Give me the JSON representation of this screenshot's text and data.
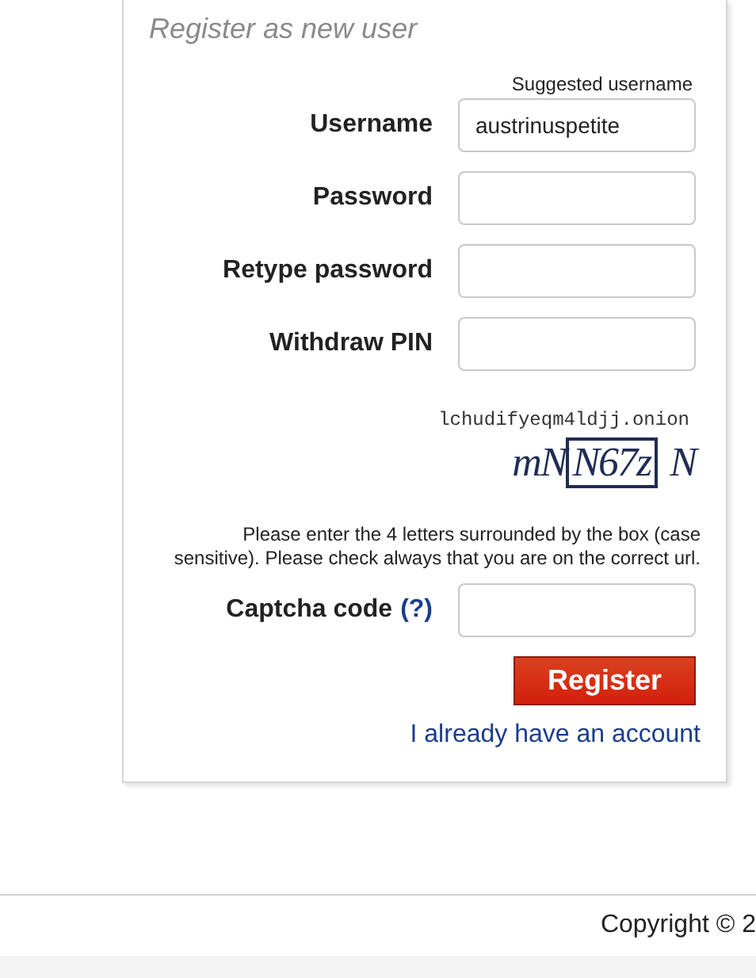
{
  "form": {
    "title": "Register as new user",
    "hint": "Suggested username",
    "fields": [
      {
        "label": "Username",
        "value": "austrinuspetite"
      },
      {
        "label": "Password"
      },
      {
        "label": "Retype password"
      },
      {
        "label": "Withdraw PIN"
      }
    ],
    "captcha": {
      "domain": "lchudifyeqm4ldjj.onion",
      "before": "mN",
      "boxed": "N67z",
      "after": "N"
    },
    "instructions": "Please enter the 4 letters surrounded by the box (case sensitive). Please check always that you are on the correct url.",
    "captcha_field": {
      "label": "Captcha code",
      "help": "(?)"
    },
    "submit": "Register",
    "login_link": "I already have an account"
  },
  "footer": {
    "copyright": "Copyright © 2"
  }
}
